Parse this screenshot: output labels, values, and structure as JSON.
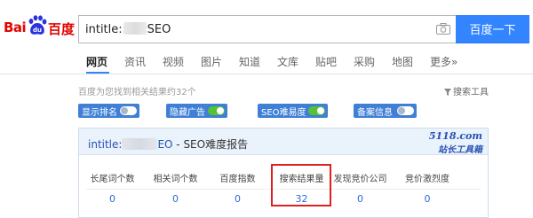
{
  "logo": {
    "left_text": "Bai",
    "right_text": "百度",
    "paw_text": "du"
  },
  "search": {
    "query_prefix": "intitle:",
    "query_suffix": "SEO",
    "button_label": "百度一下"
  },
  "tabs": [
    {
      "label": "网页",
      "active": true
    },
    {
      "label": "资讯"
    },
    {
      "label": "视频"
    },
    {
      "label": "图片"
    },
    {
      "label": "知道"
    },
    {
      "label": "文库"
    },
    {
      "label": "贴吧"
    },
    {
      "label": "采购"
    },
    {
      "label": "地图"
    },
    {
      "label": "更多»"
    }
  ],
  "results": {
    "count_text": "百度为您找到相关结果约32个",
    "tools_label": "搜索工具"
  },
  "toggles": [
    {
      "label": "显示排名",
      "on": false,
      "color": "#3f7fd6"
    },
    {
      "label": "隐藏广告",
      "on": true,
      "color": "#3f7fd6"
    },
    {
      "label": "SEO难易度",
      "on": true,
      "color": "#3f7fd6"
    },
    {
      "label": "备案信息",
      "on": false,
      "color": "#3f7fd6"
    }
  ],
  "report": {
    "title_prefix": "intitle:",
    "title_suffix": "EO",
    "title_tail": " - SEO难度报告",
    "brand_site": "5118.com",
    "brand_sub": "站长工具箱",
    "metrics": [
      {
        "label": "长尾词个数",
        "value": "0"
      },
      {
        "label": "相关词个数",
        "value": "0"
      },
      {
        "label": "百度指数",
        "value": "0"
      },
      {
        "label": "搜索结果量",
        "value": "32"
      },
      {
        "label": "发现竞价公司",
        "value": "0"
      },
      {
        "label": "竞价激烈度",
        "value": "0"
      }
    ]
  },
  "colors": {
    "brand_red": "#e10602",
    "accent_blue": "#3385ff",
    "toggle_on": "#55c234",
    "toggle_off": "#ffffff",
    "highlight": "#e02020"
  }
}
